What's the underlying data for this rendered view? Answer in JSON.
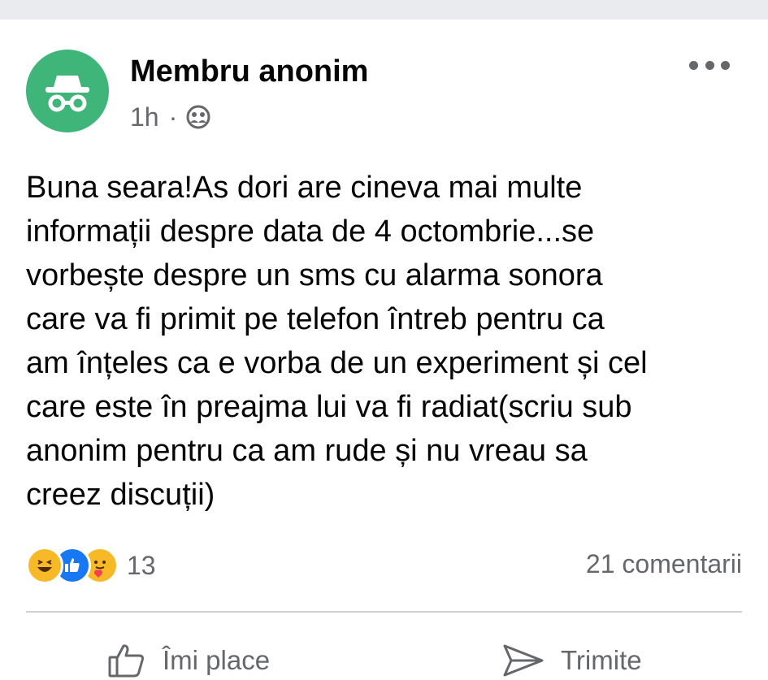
{
  "post": {
    "author": "Membru anonim",
    "time": "1h",
    "separator": "·",
    "audience_icon": "group-icon",
    "avatar_icon": "incognito-icon",
    "more_icon": "more-dots-icon",
    "body": "Buna seara!As dori are cineva mai multe\ninformații despre data de 4 octombrie...se\nvorbește despre un sms cu alarma sonora\ncare va fi primit pe telefon întreb pentru ca\nam înțeles ca e vorba de un experiment și cel\ncare este în preajma lui va fi radiat(scriu sub\nanonim pentru ca am rude și nu vreau sa\ncreez discuții)",
    "reactions": {
      "icons": [
        "haha-icon",
        "like-icon",
        "care-icon"
      ],
      "count": "13"
    },
    "comments": "21 comentarii",
    "actions": {
      "like_label": "Îmi place",
      "send_label": "Trimite"
    }
  },
  "colors": {
    "avatar_bg": "#3fb57a",
    "secondary_text": "#65676b",
    "like_blue": "#1877f2",
    "haha_yellow": "#f7b928"
  }
}
